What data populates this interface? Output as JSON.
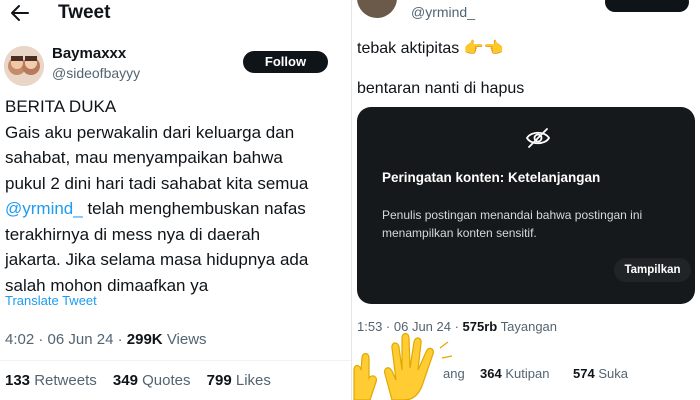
{
  "left": {
    "header": {
      "title": "Tweet"
    },
    "author": {
      "name": "Baymaxxx",
      "handle": "@sideofbayyy"
    },
    "follow_label": "Follow",
    "tweet_lines": [
      "BERITA DUKA",
      "Gais aku perwakalin dari keluarga dan",
      "sahabat, mau menyampaikan bahwa",
      "pukul 2 dini hari tadi sahabat kita semua"
    ],
    "tweet_mention": "@yrmind_",
    "tweet_after_mention": " telah menghembuskan nafas",
    "tweet_lines2": [
      "terakhirnya di mess nya di daerah",
      "jakarta. Jika selama masa hidupnya ada",
      "salah mohon dimaafkan ya"
    ],
    "translate_label": "Translate Tweet",
    "meta": {
      "time": "4:02",
      "sep": " · ",
      "date": "06 Jun 24",
      "views_count": "299K",
      "views_label": "Views"
    },
    "stats": {
      "retweets_count": "133",
      "retweets_label": "Retweets",
      "quotes_count": "349",
      "quotes_label": "Quotes",
      "likes_count": "799",
      "likes_label": "Likes"
    }
  },
  "right": {
    "handle": "@yrmind_",
    "text1": "tebak aktipitas 👉👈",
    "text2": "bentaran nanti di hapus",
    "warning": {
      "title": "Peringatan konten: Ketelanjangan",
      "description": "Penulis postingan menandai bahwa postingan ini menampilkan konten sensitif.",
      "show_label": "Tampilkan"
    },
    "meta": {
      "time": "1:53",
      "sep": " · ",
      "date": "06 Jun 24",
      "sep2": " · ",
      "views_count": "575rb",
      "views_label": "Tayangan"
    },
    "stats": {
      "reposts_label_partial": "ang",
      "quotes_count": "364",
      "quotes_label": "Kutipan",
      "likes_count": "574",
      "likes_label": "Suka"
    },
    "overlay_emoji": "waving-hands"
  },
  "colors": {
    "link": "#1d9bf0",
    "secondary_text": "#536471",
    "primary_text": "#0f1419",
    "card_bg": "#16191c"
  }
}
